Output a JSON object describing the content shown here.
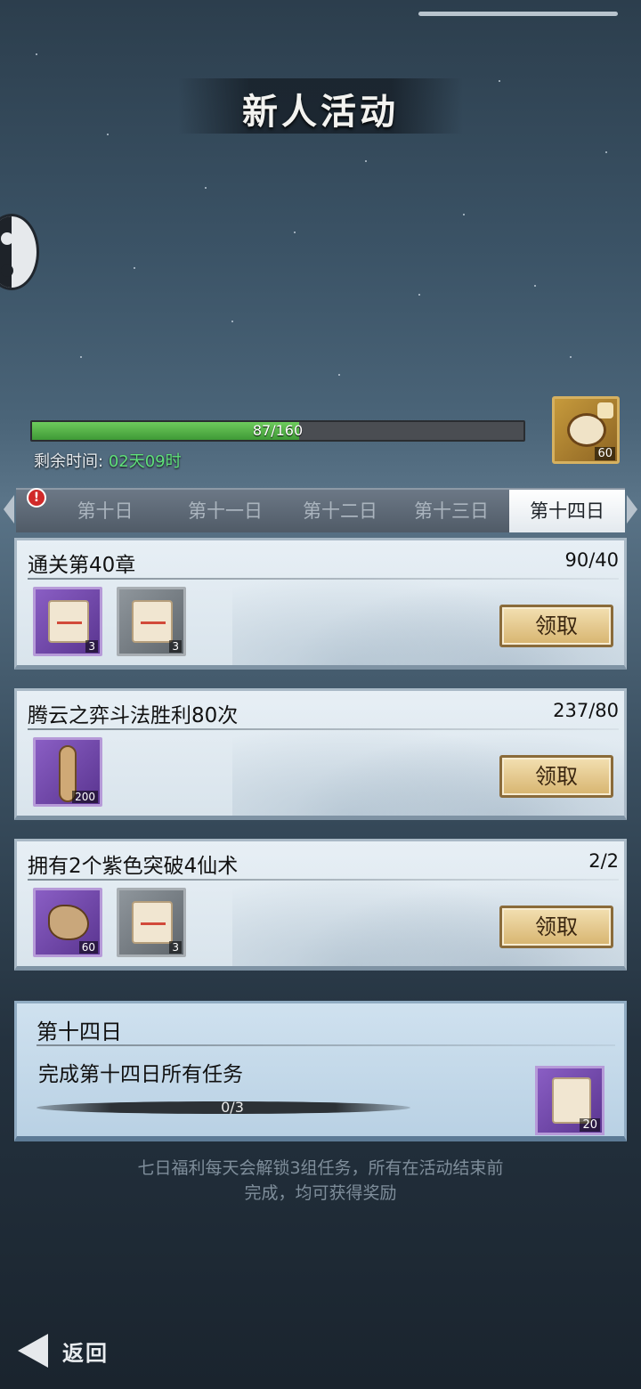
{
  "title": "新人活动",
  "progress": {
    "current": 87,
    "total": 160,
    "text": "87/160",
    "fraction": 0.544
  },
  "remaining": {
    "label": "剩余时间:",
    "value": "02天09时"
  },
  "top_reward": {
    "icon": "puzzle-chest-icon",
    "count": "60"
  },
  "alert_icon": "!",
  "tabs": [
    {
      "label": "第十日",
      "active": false
    },
    {
      "label": "第十一日",
      "active": false
    },
    {
      "label": "第十二日",
      "active": false
    },
    {
      "label": "第十三日",
      "active": false
    },
    {
      "label": "第十四日",
      "active": true
    }
  ],
  "tasks": [
    {
      "title": "通关第40章",
      "progress": "90/40",
      "claim": "领取",
      "rewards": [
        {
          "icon": "blue-scroll-icon",
          "count": "3",
          "rarity": "purple"
        },
        {
          "icon": "paper-scroll-icon",
          "count": "3",
          "rarity": "gray"
        }
      ]
    },
    {
      "title": "腾云之弈斗法胜利80次",
      "progress": "237/80",
      "claim": "领取",
      "rewards": [
        {
          "icon": "rolled-scroll-icon",
          "count": "200",
          "rarity": "purple"
        }
      ]
    },
    {
      "title": "拥有2个紫色突破4仙术",
      "progress": "2/2",
      "claim": "领取",
      "rewards": [
        {
          "icon": "puzzle-stone-icon",
          "count": "60",
          "rarity": "purple"
        },
        {
          "icon": "paper-scroll-icon",
          "count": "3",
          "rarity": "gray"
        }
      ]
    }
  ],
  "final": {
    "day": "第十四日",
    "desc": "完成第十四日所有任务",
    "progress": "0/3",
    "reward": {
      "icon": "paw-scroll-icon",
      "count": "20"
    }
  },
  "footer": {
    "line1": "七日福利每天会解锁3组任务，所有在活动结束前",
    "line2": "完成，均可获得奖励"
  },
  "back_label": "返回"
}
